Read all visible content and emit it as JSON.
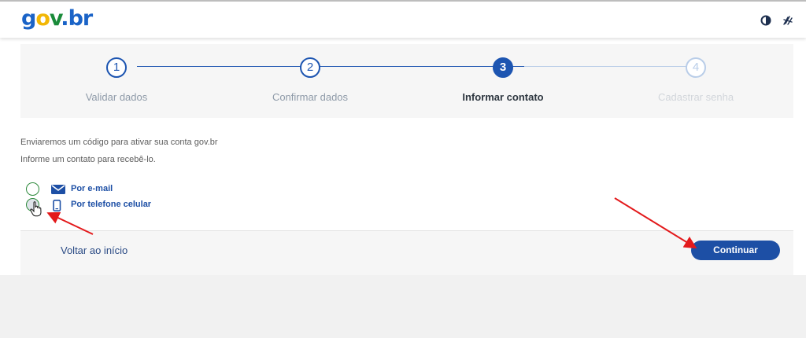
{
  "header": {
    "logo": {
      "g": "g",
      "o": "o",
      "v": "v",
      "dot": ".",
      "br": "br"
    },
    "icons": [
      "contrast-icon",
      "vlibras-icon"
    ]
  },
  "stepper": {
    "steps": [
      {
        "number": "1",
        "label": "Validar dados",
        "state": "done"
      },
      {
        "number": "2",
        "label": "Confirmar dados",
        "state": "done"
      },
      {
        "number": "3",
        "label": "Informar contato",
        "state": "active"
      },
      {
        "number": "4",
        "label": "Cadastrar senha",
        "state": "pending"
      }
    ]
  },
  "content": {
    "line1": "Enviaremos um código para ativar sua conta gov.br",
    "line2": "Informe um contato para recebê-lo.",
    "options": [
      {
        "label": "Por e-mail",
        "icon": "envelope-icon",
        "selected": false
      },
      {
        "label": "Por telefone celular",
        "icon": "mobile-phone-icon",
        "selected": false
      }
    ]
  },
  "footer": {
    "back_label": "Voltar ao início",
    "continue_label": "Continuar"
  },
  "colors": {
    "primary": "#1d4fa5",
    "radio_border": "#2e8a3c",
    "annotation_arrow": "#e3191b"
  }
}
